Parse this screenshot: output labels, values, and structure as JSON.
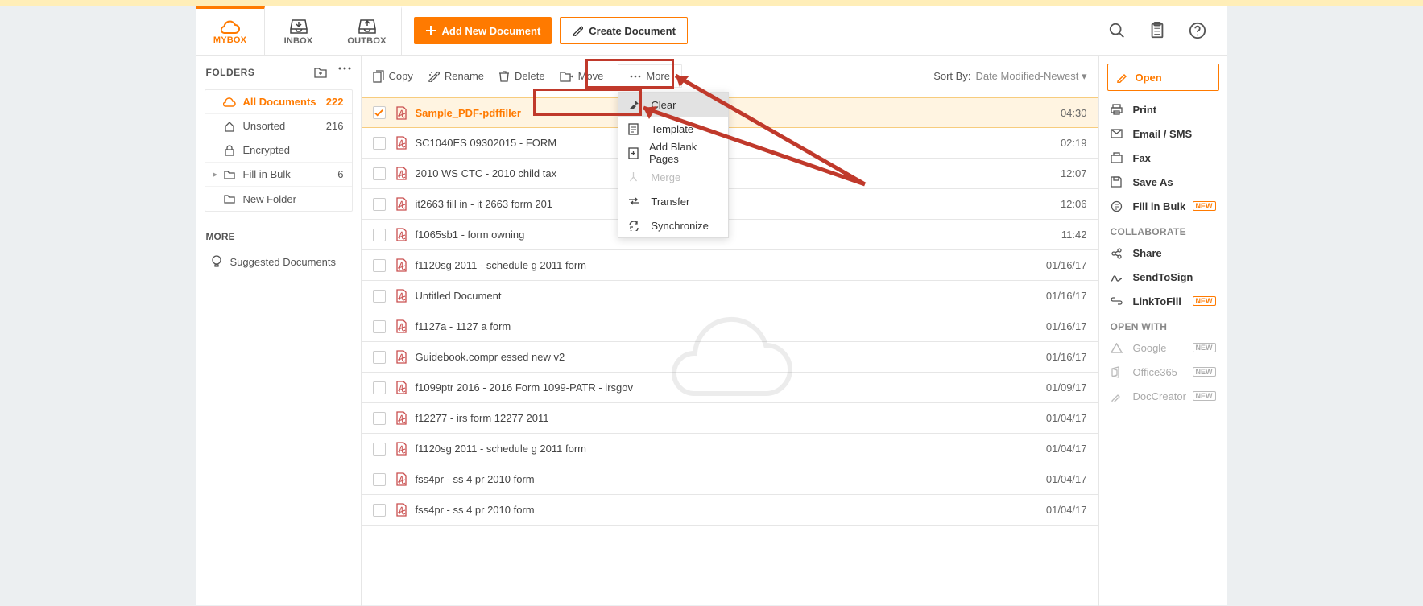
{
  "tabs": {
    "mybox": "MYBOX",
    "inbox": "INBOX",
    "outbox": "OUTBOX"
  },
  "buttons": {
    "add_doc": "Add New Document",
    "create_doc": "Create Document"
  },
  "sidebar": {
    "folders_header": "FOLDERS",
    "items": [
      {
        "label": "All Documents",
        "count": "222"
      },
      {
        "label": "Unsorted",
        "count": "216"
      },
      {
        "label": "Encrypted",
        "count": ""
      },
      {
        "label": "Fill in Bulk",
        "count": "6"
      },
      {
        "label": "New Folder",
        "count": ""
      }
    ],
    "more_header": "MORE",
    "suggested": "Suggested Documents"
  },
  "toolbar": {
    "copy": "Copy",
    "rename": "Rename",
    "delete": "Delete",
    "move": "Move",
    "more": "More"
  },
  "sort": {
    "label": "Sort By:",
    "value": "Date Modified-Newest"
  },
  "dropdown": [
    "Clear",
    "Template",
    "Add Blank Pages",
    "Merge",
    "Transfer",
    "Synchronize"
  ],
  "files": [
    {
      "name": "Sample_PDF-pdffiller",
      "date": "04:30",
      "selected": true
    },
    {
      "name": "SC1040ES 09302015 - FORM",
      "date": "02:19"
    },
    {
      "name": "2010 WS CTC - 2010 child tax",
      "date": "12:07"
    },
    {
      "name": "it2663 fill in - it 2663 form 201",
      "date": "12:06"
    },
    {
      "name": "f1065sb1 - form owning",
      "date": "11:42"
    },
    {
      "name": "f1120sg 2011 - schedule g 2011 form",
      "date": "01/16/17"
    },
    {
      "name": "Untitled Document",
      "date": "01/16/17"
    },
    {
      "name": "f1127a - 1127 a form",
      "date": "01/16/17"
    },
    {
      "name": "Guidebook.compr essed new v2",
      "date": "01/16/17"
    },
    {
      "name": "f1099ptr 2016 - 2016 Form 1099-PATR - irsgov",
      "date": "01/09/17"
    },
    {
      "name": "f12277 - irs form 12277 2011",
      "date": "01/04/17"
    },
    {
      "name": "f1120sg 2011 - schedule g 2011 form",
      "date": "01/04/17"
    },
    {
      "name": "fss4pr - ss 4 pr 2010 form",
      "date": "01/04/17"
    },
    {
      "name": "fss4pr - ss 4 pr 2010 form",
      "date": "01/04/17"
    }
  ],
  "right": {
    "open": "Open",
    "print": "Print",
    "email_sms": "Email / SMS",
    "fax": "Fax",
    "save_as": "Save As",
    "fill_in_bulk": "Fill in Bulk",
    "collaborate": "COLLABORATE",
    "share": "Share",
    "sendtosign": "SendToSign",
    "linktofill": "LinkToFill",
    "open_with": "OPEN WITH",
    "google": "Google",
    "office365": "Office365",
    "doccreator": "DocCreator",
    "new": "NEW"
  }
}
